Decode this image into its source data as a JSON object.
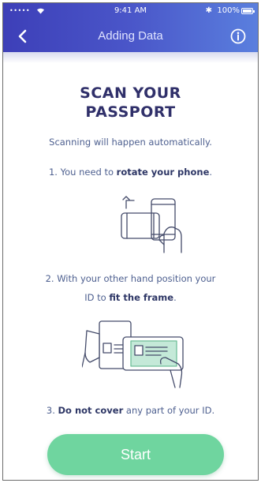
{
  "statusbar": {
    "signal": "•••••",
    "time": "9:41 AM",
    "bluetooth": "✱",
    "battery": "100%"
  },
  "nav": {
    "title": "Adding Data",
    "back_icon": "chevron-left-icon",
    "info_icon": "info-icon"
  },
  "content": {
    "title_line1": "SCAN YOUR",
    "title_line2": "PASSPORT",
    "subtitle": "Scanning will happen automatically.",
    "step1_prefix": "1. You need to ",
    "step1_bold": "rotate your phone",
    "step1_suffix": ".",
    "step2_line1": "2. With your other hand position your",
    "step2_prefix": "ID to ",
    "step2_bold": "fit the frame",
    "step2_suffix": ".",
    "step3_prefix": "3. ",
    "step3_bold": "Do not cover",
    "step3_suffix": " any part of your ID."
  },
  "actions": {
    "start_label": "Start"
  },
  "colors": {
    "header_start": "#3d3fb8",
    "header_end": "#5a7fde",
    "title": "#30306a",
    "body_text": "#4d5f8f",
    "start_button": "#6fd59f"
  }
}
